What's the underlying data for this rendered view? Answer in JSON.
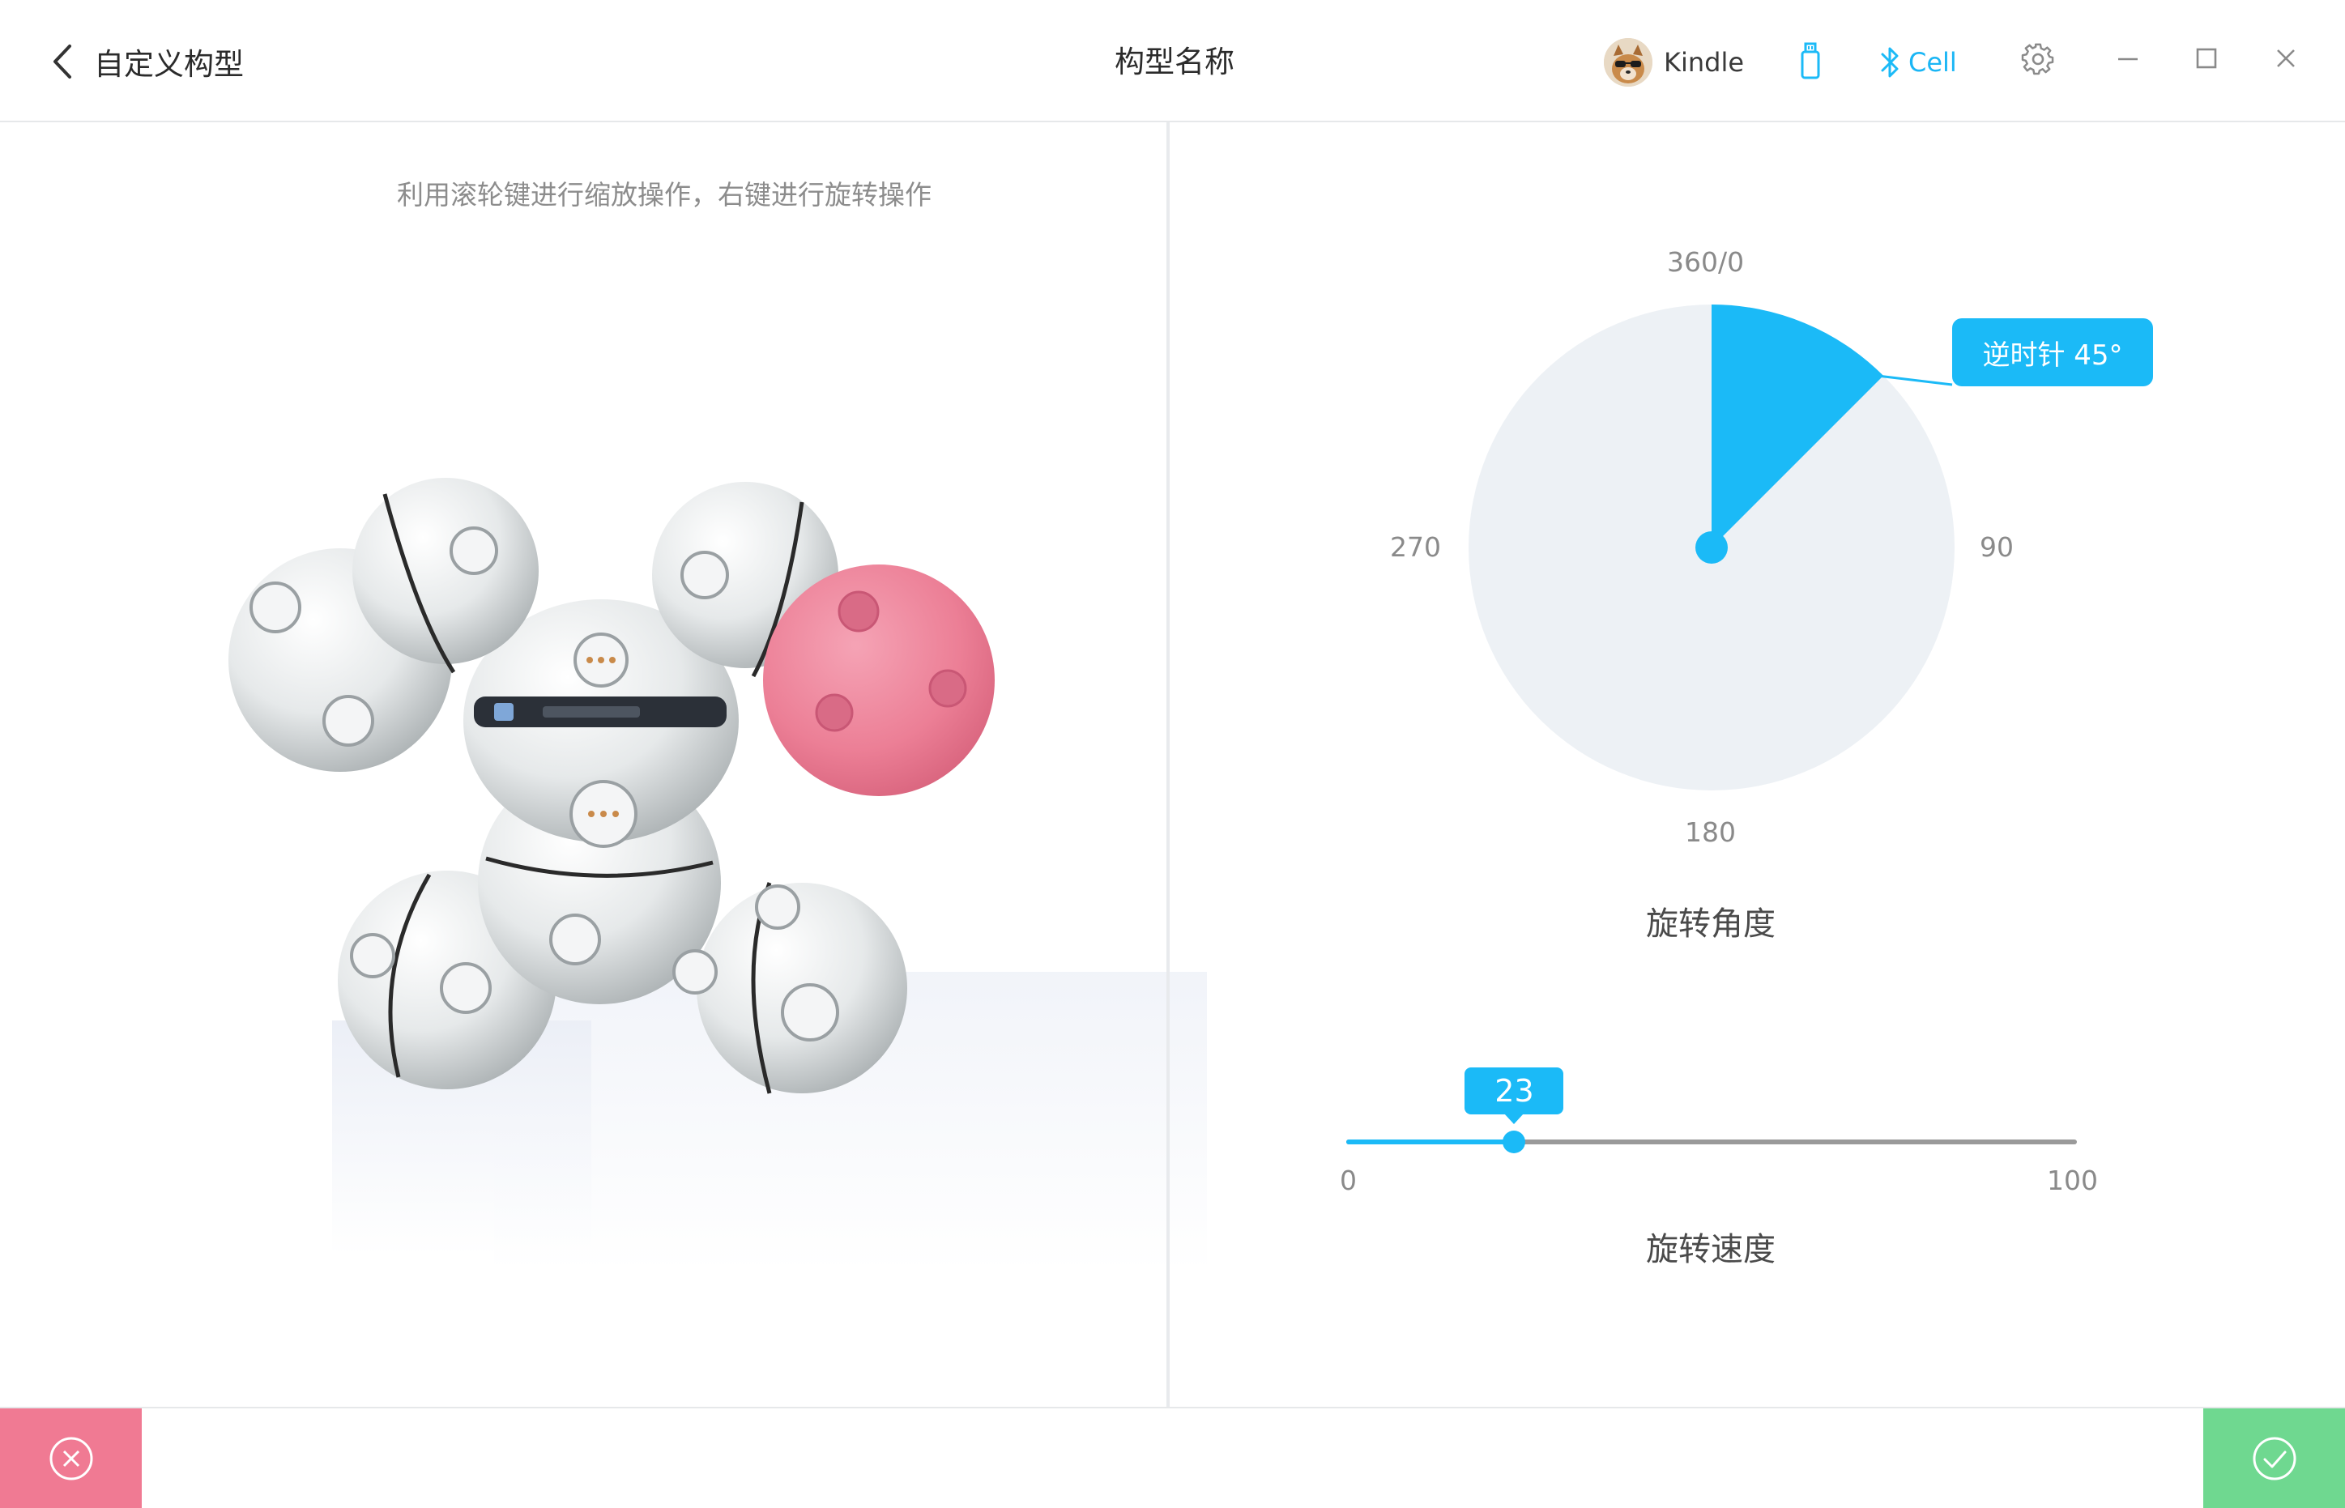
{
  "header": {
    "back_label": "自定义构型",
    "title": "构型名称",
    "user_name": "Kindle",
    "bluetooth_label": "Cell"
  },
  "left_pane": {
    "hint": "利用滚轮键进行缩放操作，右键进行旋转操作"
  },
  "rotation_dial": {
    "label_top": "360/0",
    "label_right": "90",
    "label_bottom": "180",
    "label_left": "270",
    "tooltip": "逆时针 45°",
    "angle": 45,
    "title": "旋转角度"
  },
  "speed_slider": {
    "value": 23,
    "value_text": "23",
    "min_label": "0",
    "max_label": "100",
    "title": "旋转速度"
  },
  "colors": {
    "accent": "#1bbaf7",
    "cancel": "#f07a93",
    "confirm": "#6fd890",
    "dial_bg": "#edf1f5",
    "highlight_module": "#ec7f96"
  },
  "icons": {
    "back": "chevron-left-icon",
    "usb": "usb-icon",
    "bluetooth": "bluetooth-icon",
    "settings": "gear-icon",
    "minimize": "minimize-icon",
    "maximize": "maximize-icon",
    "close": "close-icon",
    "cancel": "cancel-circle-icon",
    "confirm": "check-circle-icon"
  }
}
